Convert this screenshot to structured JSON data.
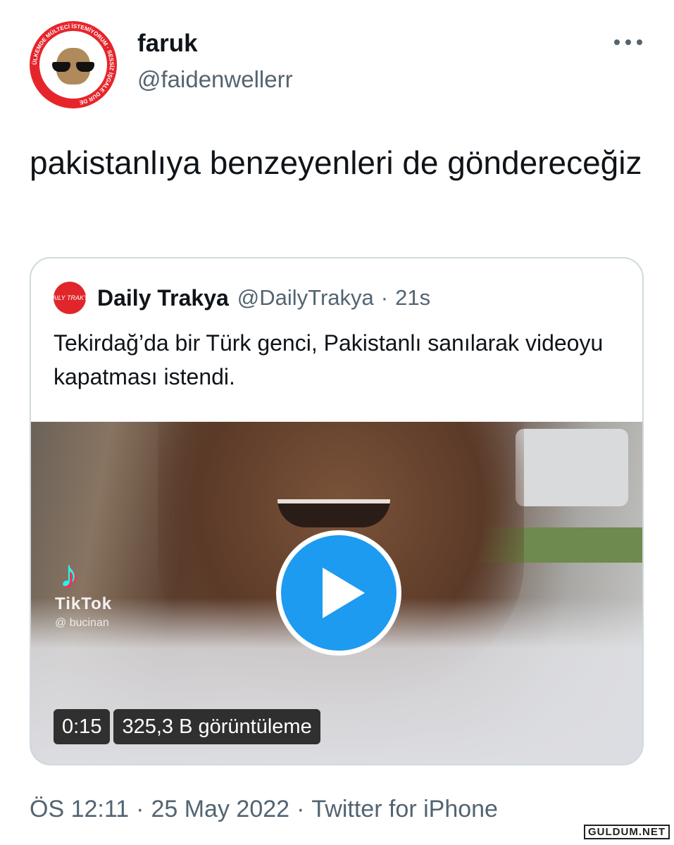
{
  "author": {
    "name": "faruk",
    "handle": "@faidenwellerr",
    "avatar_text": "ÜLKEMDE MÜLTECİ İSTEMİYORUM · SESSİZ İŞGALE DUR DE"
  },
  "tweet": {
    "text": "pakistanlıya benzeyenleri de göndereceğiz"
  },
  "quote": {
    "logo_text": "DAILY TRAKYA",
    "name": "Daily Trakya",
    "handle": "@DailyTrakya",
    "separator": "·",
    "time": "21s",
    "text": "Tekirdağ’da bir Türk genci, Pakistanlı sanılarak videoyu kapatması istendi.",
    "video": {
      "tiktok_label": "TikTok",
      "tiktok_user": "@ bucinan",
      "duration": "0:15",
      "views": "325,3 B görüntüleme"
    }
  },
  "meta": {
    "time": "ÖS 12:11",
    "date": "25 May 2022",
    "source": "Twitter for iPhone",
    "separator": "·"
  },
  "watermark": "GULDUM.NET",
  "colors": {
    "play_button": "#1d9bf0",
    "secondary_text": "#536471",
    "avatar_red": "#e6252b"
  }
}
